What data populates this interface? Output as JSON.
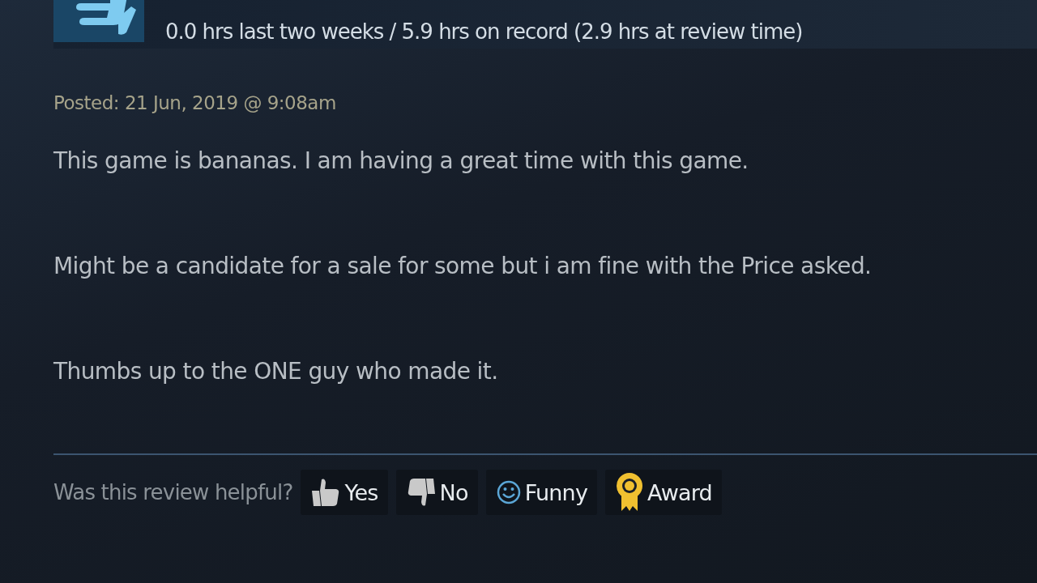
{
  "header": {
    "playtime": "0.0 hrs last two weeks / 5.9 hrs on record (2.9 hrs at review time)"
  },
  "posted": "Posted: 21 Jun, 2019 @ 9:08am",
  "review": [
    "This game is bananas. I am having a great time with this game.",
    "Might be a candidate for a sale for some but i am fine with the Price asked.",
    "Thumbs up to the ONE guy who made it."
  ],
  "helpful": {
    "question": "Was this review helpful?",
    "buttons": [
      {
        "kind": "yes",
        "label": "Yes"
      },
      {
        "kind": "no",
        "label": "No"
      },
      {
        "kind": "funny",
        "label": "Funny"
      },
      {
        "kind": "award",
        "label": "Award"
      }
    ]
  }
}
